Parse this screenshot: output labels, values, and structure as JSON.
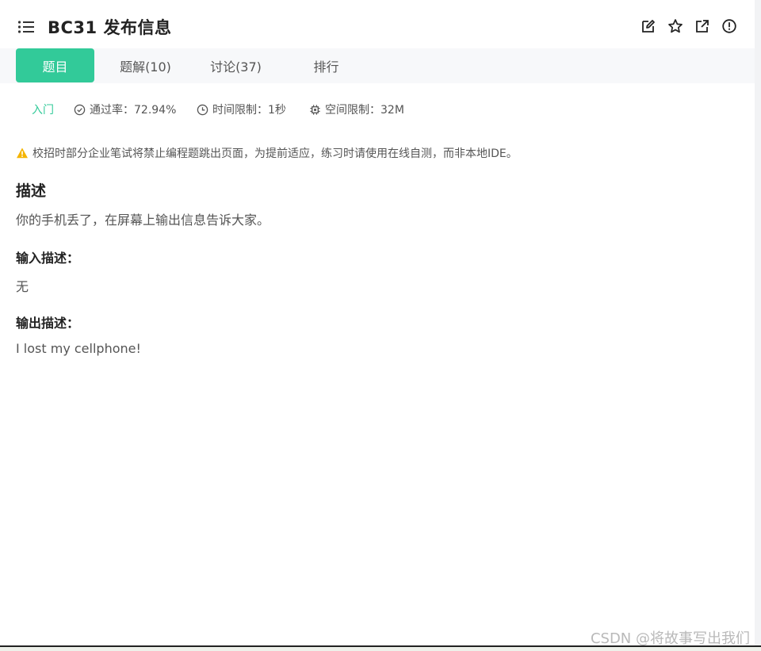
{
  "header": {
    "title": "BC31  发布信息",
    "actions": [
      {
        "name": "edit-icon"
      },
      {
        "name": "star-icon"
      },
      {
        "name": "share-icon"
      },
      {
        "name": "alert-icon"
      }
    ]
  },
  "tabs": [
    {
      "label": "题目",
      "active": true
    },
    {
      "label": "题解(10)",
      "active": false
    },
    {
      "label": "讨论(37)",
      "active": false
    },
    {
      "label": "排行",
      "active": false
    }
  ],
  "meta": {
    "level": "入门",
    "pass_rate": "通过率：72.94%",
    "time_limit": "时间限制：1秒",
    "memory_limit": "空间限制：32M"
  },
  "notice": "校招时部分企业笔试将禁止编程题跳出页面，为提前适应，练习时请使用在线自测，而非本地IDE。",
  "description": {
    "heading": "描述",
    "text": "你的手机丢了，在屏幕上输出信息告诉大家。"
  },
  "input": {
    "heading": "输入描述：",
    "text": "无"
  },
  "output": {
    "heading": "输出描述：",
    "text": "I lost my cellphone!"
  },
  "watermark": "CSDN @将故事写出我们",
  "colors": {
    "accent": "#32ca99",
    "warning": "#f5b400"
  }
}
